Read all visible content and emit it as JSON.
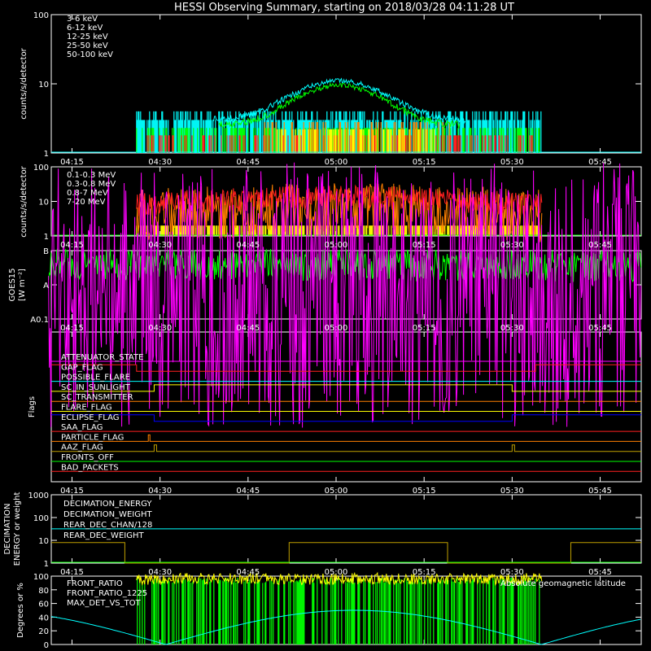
{
  "title": "HESSI Observing Summary, starting on 2018/03/28 04:11:28 UT",
  "time_ticks": [
    "04:15",
    "04:30",
    "04:45",
    "05:00",
    "05:15",
    "05:30",
    "05:45"
  ],
  "colors": {
    "red": "#ff2020",
    "orange": "#ff8000",
    "yellow": "#ffff00",
    "green": "#00ff00",
    "cyan": "#00ffff",
    "magenta": "#ff00ff",
    "blue": "#0000ff",
    "white": "#ffffff"
  },
  "panels": {
    "lo": {
      "ylabel": "counts/s/detector",
      "yticks": [
        "1",
        "10",
        "100"
      ],
      "legend": [
        {
          "label": "3-6 keV",
          "color": "#ff2020"
        },
        {
          "label": "6-12 keV",
          "color": "#ff8000"
        },
        {
          "label": "12-25 keV",
          "color": "#ffff00"
        },
        {
          "label": "25-50 keV",
          "color": "#00ff00"
        },
        {
          "label": "50-100 keV",
          "color": "#00ffff"
        }
      ]
    },
    "hi": {
      "ylabel": "counts/s/detector",
      "yticks": [
        "1",
        "10",
        "100"
      ],
      "legend": [
        {
          "label": "0.1-0.3 MeV",
          "color": "#ff2020"
        },
        {
          "label": "0.3-0.8 MeV",
          "color": "#ff8000"
        },
        {
          "label": "0.8-7 MeV",
          "color": "#ffff00"
        },
        {
          "label": "7-20 MeV",
          "color": "#00ff00"
        }
      ]
    },
    "goes": {
      "ylabel1": "GOES15",
      "ylabel2": "[W m⁻²]",
      "yticks": [
        "A0.1",
        "A",
        "B"
      ]
    },
    "flags": {
      "ylabel": "Flags",
      "items": [
        {
          "label": "ATTENUATOR_STATE",
          "color": "#ff00ff"
        },
        {
          "label": "GAP_FLAG",
          "color": "#ff2020"
        },
        {
          "label": "POSSIBLE_FLARE",
          "color": "#00ffff"
        },
        {
          "label": "SC_IN_SUNLIGHT",
          "color": "#ffff00"
        },
        {
          "label": "SC_TRANSMITTER",
          "color": "#ff8000"
        },
        {
          "label": "FLARE_FLAG",
          "color": "#ffff00"
        },
        {
          "label": "ECLIPSE_FLAG",
          "color": "#0000ff"
        },
        {
          "label": "SAA_FLAG",
          "color": "#ff2020"
        },
        {
          "label": "PARTICLE_FLAG",
          "color": "#ff8000"
        },
        {
          "label": "AAZ_FLAG",
          "color": "#c0a000"
        },
        {
          "label": "FRONTS_OFF",
          "color": "#00ff00"
        },
        {
          "label": "BAD_PACKETS",
          "color": "#ff2020"
        }
      ]
    },
    "dec": {
      "ylabel1": "DECIMATION",
      "ylabel2": "ENERGY or weight",
      "yticks": [
        "1",
        "10",
        "100",
        "1000"
      ],
      "legend": [
        {
          "label": "DECIMATION_ENERGY",
          "color": "#00ff00"
        },
        {
          "label": "DECIMATION_WEIGHT",
          "color": "#ff8000"
        },
        {
          "label": "REAR_DEC_CHAN/128",
          "color": "#00ffff"
        },
        {
          "label": "REAR_DEC_WEIGHT",
          "color": "#c0a000"
        }
      ]
    },
    "ratio": {
      "ylabel": "Degrees or %",
      "yticks": [
        "0",
        "20",
        "40",
        "60",
        "80",
        "100"
      ],
      "legend": [
        {
          "label": "FRONT_RATIO",
          "color": "#ffff00"
        },
        {
          "label": "FRONT_RATIO_1225",
          "color": "#00ff00"
        },
        {
          "label": "MAX_DET_VS_TOT",
          "color": "#ff8000"
        }
      ],
      "legend_right": "Absolute geomagnetic latitude"
    }
  },
  "chart_data": [
    {
      "type": "line",
      "title": "HESSI Observing Summary, starting on 2018/03/28 04:11:28 UT",
      "ylabel": "counts/s/detector",
      "yscale": "log",
      "ylim": [
        1,
        100
      ],
      "xlim": [
        "04:11:28",
        "05:52"
      ],
      "series": [
        {
          "name": "3-6 keV",
          "x": [
            "04:26",
            "04:45",
            "05:00",
            "05:05",
            "05:20",
            "05:35"
          ],
          "values": [
            1,
            1,
            2,
            3,
            2,
            1
          ]
        },
        {
          "name": "6-12 keV",
          "x": [
            "04:26",
            "04:45",
            "05:00",
            "05:05",
            "05:20",
            "05:35"
          ],
          "values": [
            1,
            1,
            2.5,
            3,
            2,
            1
          ]
        },
        {
          "name": "12-25 keV",
          "x": [
            "04:26",
            "04:45",
            "05:00",
            "05:05",
            "05:20",
            "05:35"
          ],
          "values": [
            1,
            1,
            2,
            2.5,
            1.5,
            1
          ]
        },
        {
          "name": "25-50 keV",
          "x": [
            "04:26",
            "04:45",
            "05:00",
            "05:05",
            "05:20",
            "05:35"
          ],
          "values": [
            2.5,
            3,
            9,
            10,
            4,
            2.5
          ]
        },
        {
          "name": "50-100 keV",
          "x": [
            "04:26",
            "04:40",
            "04:50",
            "05:00",
            "05:05",
            "05:15",
            "05:20",
            "05:35"
          ],
          "values": [
            3,
            3,
            5,
            9,
            11,
            9,
            5,
            3
          ]
        }
      ]
    },
    {
      "type": "line",
      "ylabel": "counts/s/detector",
      "yscale": "log",
      "ylim": [
        1,
        100
      ],
      "series": [
        {
          "name": "0.1-0.3 MeV",
          "x": [
            "04:26",
            "04:45",
            "05:05",
            "05:20",
            "05:35"
          ],
          "values": [
            6,
            9,
            13,
            9,
            6
          ]
        },
        {
          "name": "0.3-0.8 MeV",
          "x": [
            "04:26",
            "04:45",
            "05:05",
            "05:20",
            "05:35"
          ],
          "values": [
            3,
            4.5,
            6,
            4.5,
            3
          ]
        },
        {
          "name": "0.8-7 MeV",
          "x": [
            "04:26",
            "04:45",
            "05:05",
            "05:20",
            "05:35"
          ],
          "values": [
            2,
            2,
            2.5,
            2,
            2
          ]
        },
        {
          "name": "7-20 MeV",
          "x": [
            "04:11",
            "05:52"
          ],
          "values": [
            1,
            1
          ]
        }
      ]
    },
    {
      "type": "line",
      "ylabel": "GOES15 [W m⁻²]",
      "yscale": "log",
      "yticks": [
        "A0.1",
        "A",
        "B"
      ],
      "series": [
        {
          "x": [
            "04:11",
            "04:30",
            "05:00",
            "05:30",
            "05:52"
          ],
          "values": [
            "A4",
            "A3.7",
            "A3.6",
            "A3.6",
            "A3.5"
          ]
        },
        {
          "x": [
            "04:11",
            "04:30",
            "05:00",
            "05:30",
            "05:52"
          ],
          "values": [
            "A0.5",
            "A0.5",
            "A0.5",
            "A0.5",
            "A0.5"
          ]
        }
      ]
    },
    {
      "type": "line",
      "ylabel": "Flags",
      "series": [
        {
          "name": "GAP_FLAG",
          "x": [
            "04:11",
            "04:26",
            "04:26",
            "05:34",
            "05:34",
            "05:52"
          ],
          "values": [
            1,
            1,
            0,
            0,
            1,
            1
          ]
        },
        {
          "name": "SC_IN_SUNLIGHT",
          "x": [
            "04:11",
            "04:29",
            "04:29",
            "05:30",
            "05:30",
            "05:52"
          ],
          "values": [
            0,
            0,
            1,
            1,
            0,
            0
          ]
        },
        {
          "name": "ECLIPSE_FLAG",
          "x": [
            "04:11",
            "04:29",
            "04:29",
            "05:30",
            "05:30",
            "05:52"
          ],
          "values": [
            1,
            1,
            0,
            0,
            1,
            1
          ]
        }
      ]
    },
    {
      "type": "line",
      "ylabel": "DECIMATION ENERGY or weight",
      "yscale": "log",
      "ylim": [
        1,
        1000
      ],
      "series": [
        {
          "name": "REAR_DEC_CHAN/128",
          "x": [
            "04:11",
            "05:52"
          ],
          "values": [
            32,
            32
          ]
        },
        {
          "name": "REAR_DEC_WEIGHT",
          "x": [
            "04:11",
            "04:24",
            "04:24",
            "04:52",
            "04:52",
            "05:19",
            "05:19",
            "05:40",
            "05:40",
            "05:52"
          ],
          "values": [
            8,
            8,
            1,
            1,
            8,
            8,
            1,
            1,
            8,
            8
          ]
        }
      ]
    },
    {
      "type": "line",
      "ylabel": "Degrees or %",
      "ylim": [
        0,
        100
      ],
      "series": [
        {
          "name": "FRONT_RATIO",
          "x": [
            "04:26",
            "05:35"
          ],
          "values": [
            97,
            97
          ]
        },
        {
          "name": "Absolute geomagnetic latitude",
          "x": [
            "04:11",
            "04:30",
            "05:03",
            "05:35",
            "05:52"
          ],
          "values": [
            48,
            0,
            50,
            0,
            48
          ]
        }
      ]
    }
  ]
}
